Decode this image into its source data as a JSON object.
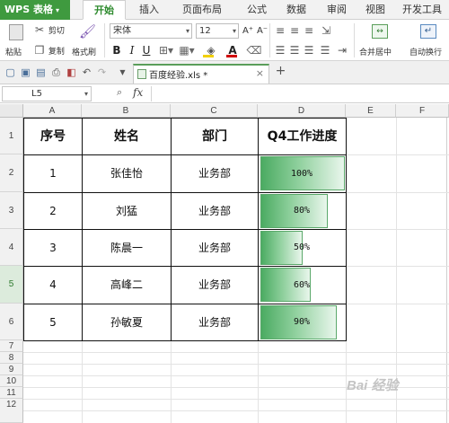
{
  "app": {
    "name": "WPS 表格",
    "menu_caret": "▾"
  },
  "menu_tabs": [
    "开始",
    "插入",
    "页面布局",
    "公式",
    "数据",
    "审阅",
    "视图",
    "开发工具"
  ],
  "active_tab": "开始",
  "ribbon": {
    "paste_label": "粘贴",
    "cut_label": "剪切",
    "copy_label": "复制",
    "format_painter_label": "格式刷",
    "font_name": "宋体",
    "font_size": "12",
    "bold": "B",
    "italic": "I",
    "underline": "U",
    "grow_font": "A⁺",
    "shrink_font": "A⁻",
    "merge_label": "合并居中",
    "wrap_label": "自动换行"
  },
  "document": {
    "tab_name": "百度经验.xls *"
  },
  "formula_bar": {
    "cell_ref": "L5",
    "fx": "fx"
  },
  "columns": [
    "A",
    "B",
    "C",
    "D",
    "E",
    "F"
  ],
  "rows": [
    "1",
    "2",
    "3",
    "4",
    "5",
    "6",
    "7",
    "8",
    "9",
    "10",
    "11",
    "12"
  ],
  "selected_row": "5",
  "table": {
    "headers": [
      "序号",
      "姓名",
      "部门",
      "Q4工作进度"
    ],
    "records": [
      {
        "no": "1",
        "name": "张佳怡",
        "dept": "业务部",
        "progress": "100%",
        "fraction": 1.0
      },
      {
        "no": "2",
        "name": "刘猛",
        "dept": "业务部",
        "progress": "80%",
        "fraction": 0.8
      },
      {
        "no": "3",
        "name": "陈晨一",
        "dept": "业务部",
        "progress": "50%",
        "fraction": 0.5
      },
      {
        "no": "4",
        "name": "高峰二",
        "dept": "业务部",
        "progress": "60%",
        "fraction": 0.6
      },
      {
        "no": "5",
        "name": "孙敏夏",
        "dept": "业务部",
        "progress": "90%",
        "fraction": 0.9
      }
    ]
  },
  "watermark": "Bai 经验",
  "colors": {
    "accent": "#3f9a3f",
    "bar_start": "#4bab62",
    "bar_end": "#e9f6ec"
  }
}
